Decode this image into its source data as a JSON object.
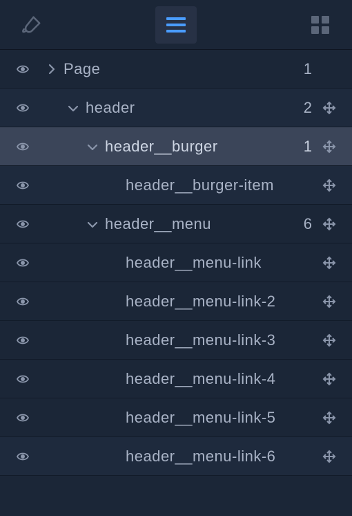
{
  "toolbar": {
    "brush_active": false,
    "list_active": true,
    "grid_active": false
  },
  "colors": {
    "accent": "#4a9cff",
    "icon": "#8994aa",
    "icon_dim": "#5b6679"
  },
  "tree": [
    {
      "id": "page",
      "label": "Page",
      "depth": 0,
      "arrow": "right",
      "count": "1",
      "move": false,
      "selected": false,
      "bg": "alt2"
    },
    {
      "id": "header",
      "label": "header",
      "depth": 1,
      "arrow": "down",
      "count": "2",
      "move": true,
      "selected": false,
      "bg": "alt1"
    },
    {
      "id": "burger",
      "label": "header__burger",
      "depth": 2,
      "arrow": "down",
      "count": "1",
      "move": true,
      "selected": true,
      "bg": "sel"
    },
    {
      "id": "bitem",
      "label": "header__burger-item",
      "depth": 3,
      "arrow": "none",
      "count": "",
      "move": true,
      "selected": false,
      "bg": "alt1"
    },
    {
      "id": "menu",
      "label": "header__menu",
      "depth": 2,
      "arrow": "down",
      "count": "6",
      "move": true,
      "selected": false,
      "bg": "alt2"
    },
    {
      "id": "ml1",
      "label": "header__menu-link",
      "depth": 3,
      "arrow": "none",
      "count": "",
      "move": true,
      "selected": false,
      "bg": "alt2"
    },
    {
      "id": "ml2",
      "label": "header__menu-link-2",
      "depth": 3,
      "arrow": "none",
      "count": "",
      "move": true,
      "selected": false,
      "bg": "alt2"
    },
    {
      "id": "ml3",
      "label": "header__menu-link-3",
      "depth": 3,
      "arrow": "none",
      "count": "",
      "move": true,
      "selected": false,
      "bg": "alt2"
    },
    {
      "id": "ml4",
      "label": "header__menu-link-4",
      "depth": 3,
      "arrow": "none",
      "count": "",
      "move": true,
      "selected": false,
      "bg": "alt2"
    },
    {
      "id": "ml5",
      "label": "header__menu-link-5",
      "depth": 3,
      "arrow": "none",
      "count": "",
      "move": true,
      "selected": false,
      "bg": "alt2"
    },
    {
      "id": "ml6",
      "label": "header__menu-link-6",
      "depth": 3,
      "arrow": "none",
      "count": "",
      "move": true,
      "selected": false,
      "bg": "alt1"
    }
  ]
}
